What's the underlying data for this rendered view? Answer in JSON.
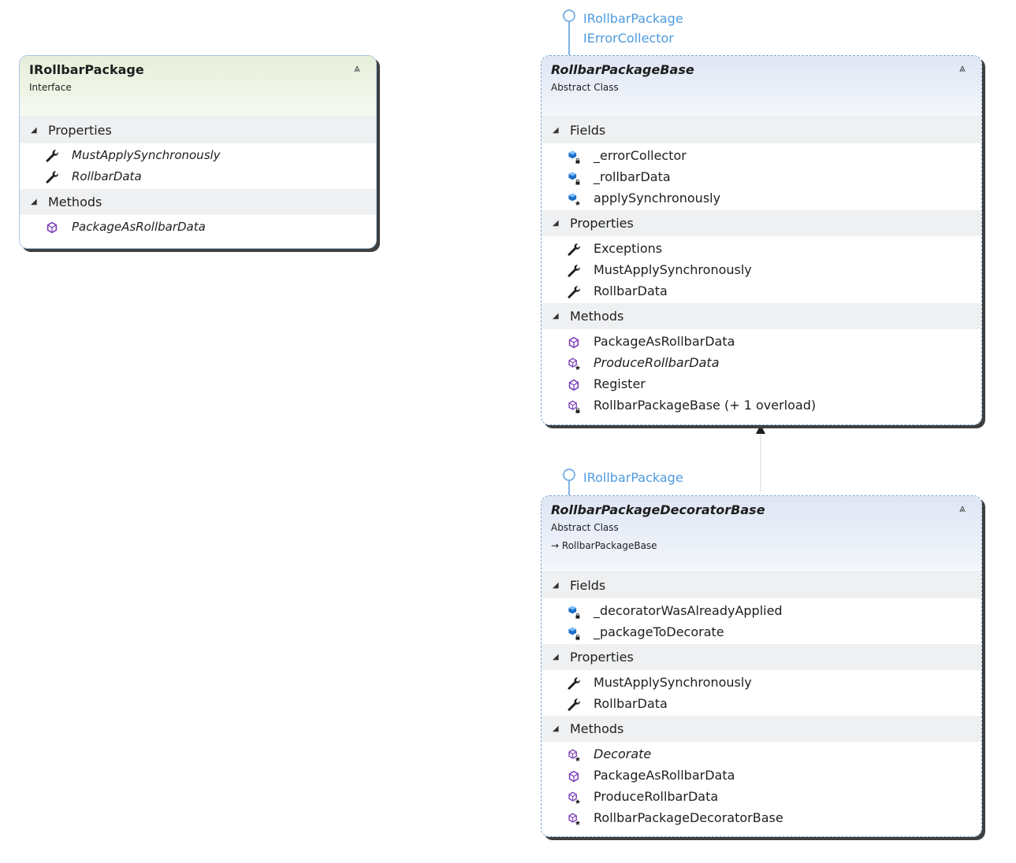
{
  "interfaces_shape": {
    "name": "IRollbarPackage",
    "kind": "Interface",
    "sections": [
      {
        "label": "Properties",
        "members": [
          {
            "icon": "property-icon",
            "label": "MustApplySynchronously",
            "italic": true
          },
          {
            "icon": "property-icon",
            "label": "RollbarData",
            "italic": true
          }
        ]
      },
      {
        "label": "Methods",
        "members": [
          {
            "icon": "method-icon",
            "label": "PackageAsRollbarData",
            "italic": true
          }
        ]
      }
    ]
  },
  "base_shape": {
    "lollipop_labels": [
      "IRollbarPackage",
      "IErrorCollector"
    ],
    "name": "RollbarPackageBase",
    "kind": "Abstract Class",
    "sections": [
      {
        "label": "Fields",
        "members": [
          {
            "icon": "private-field-icon",
            "label": "_errorCollector",
            "italic": false
          },
          {
            "icon": "private-field-icon",
            "label": "_rollbarData",
            "italic": false
          },
          {
            "icon": "protected-field-icon",
            "label": "applySynchronously",
            "italic": false
          }
        ]
      },
      {
        "label": "Properties",
        "members": [
          {
            "icon": "property-icon",
            "label": "Exceptions",
            "italic": false
          },
          {
            "icon": "property-icon",
            "label": "MustApplySynchronously",
            "italic": false
          },
          {
            "icon": "property-icon",
            "label": "RollbarData",
            "italic": false
          }
        ]
      },
      {
        "label": "Methods",
        "members": [
          {
            "icon": "method-icon",
            "label": "PackageAsRollbarData",
            "italic": false
          },
          {
            "icon": "protected-method-icon",
            "label": "ProduceRollbarData",
            "italic": true
          },
          {
            "icon": "method-icon",
            "label": "Register",
            "italic": false
          },
          {
            "icon": "private-method-icon",
            "label": "RollbarPackageBase (+ 1 overload)",
            "italic": false
          }
        ]
      }
    ]
  },
  "decorator_shape": {
    "lollipop_labels": [
      "IRollbarPackage"
    ],
    "name": "RollbarPackageDecoratorBase",
    "kind": "Abstract Class",
    "base_class": "RollbarPackageBase",
    "sections": [
      {
        "label": "Fields",
        "members": [
          {
            "icon": "private-field-icon",
            "label": "_decoratorWasAlreadyApplied",
            "italic": false
          },
          {
            "icon": "private-field-icon",
            "label": "_packageToDecorate",
            "italic": false
          }
        ]
      },
      {
        "label": "Properties",
        "members": [
          {
            "icon": "property-icon",
            "label": "MustApplySynchronously",
            "italic": false
          },
          {
            "icon": "property-icon",
            "label": "RollbarData",
            "italic": false
          }
        ]
      },
      {
        "label": "Methods",
        "members": [
          {
            "icon": "protected-method-icon",
            "label": "Decorate",
            "italic": true
          },
          {
            "icon": "method-icon",
            "label": "PackageAsRollbarData",
            "italic": false
          },
          {
            "icon": "protected-method-icon",
            "label": "ProduceRollbarData",
            "italic": false
          },
          {
            "icon": "protected-method-icon",
            "label": "RollbarPackageDecoratorBase",
            "italic": false
          }
        ]
      }
    ]
  },
  "colors": {
    "lollipop": "#7fb3e6",
    "lollipop_text": "#4d9be0",
    "method": "#7b3fb8",
    "field": "#1e6fc4"
  },
  "glyphs": {
    "collapse": "⩓",
    "section_toggle": "◢",
    "inherits_arrow": "→"
  }
}
